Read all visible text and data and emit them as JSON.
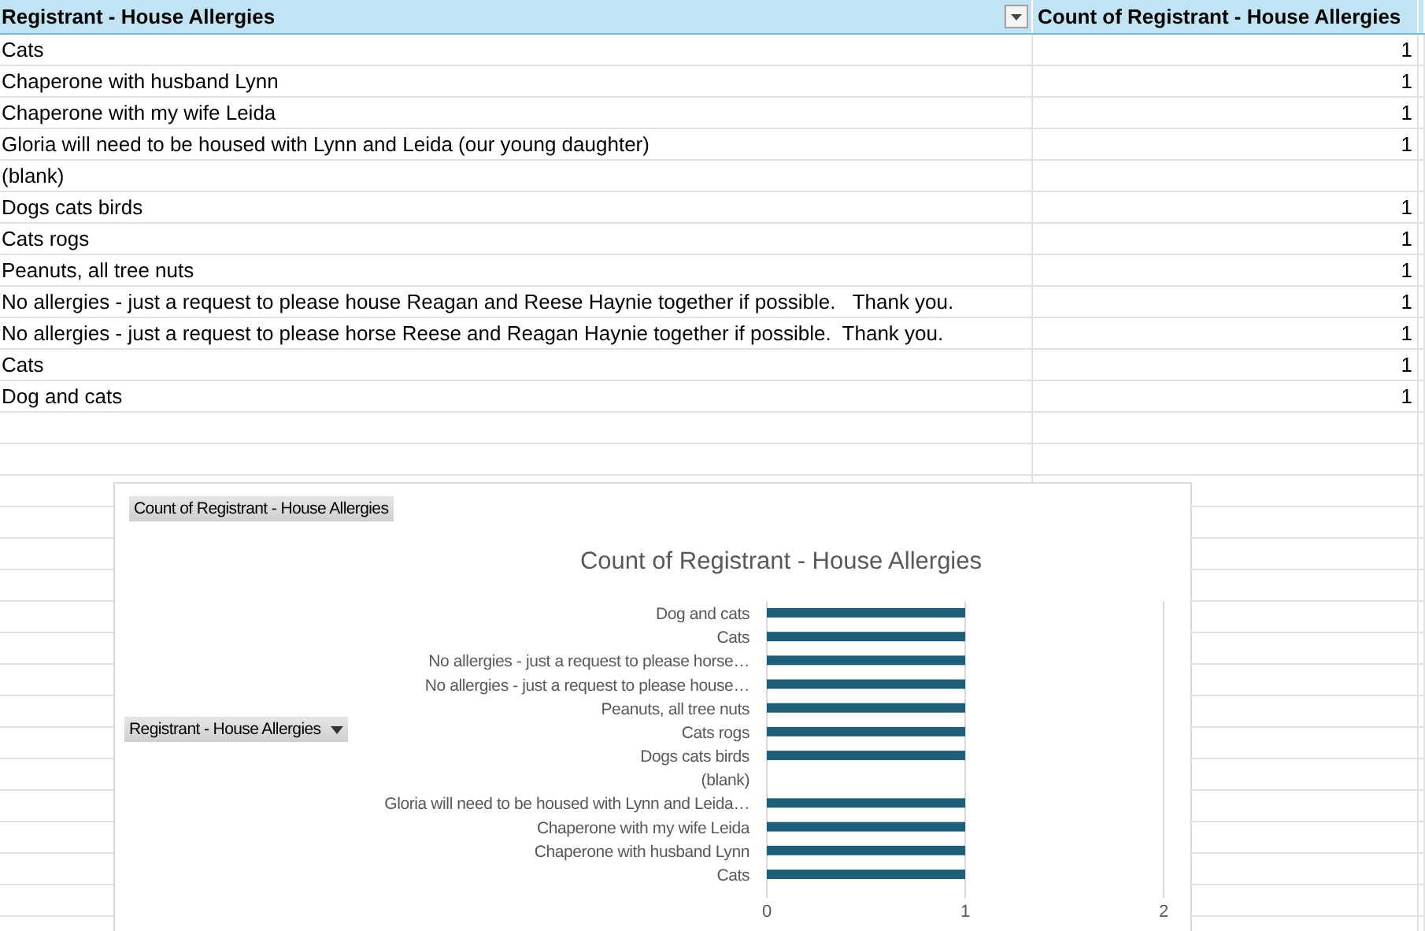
{
  "pivot_table": {
    "columns": [
      {
        "label": "Registrant - House Allergies",
        "filter_button": true
      },
      {
        "label": "Count of Registrant - House Allergies",
        "filter_button": false
      }
    ],
    "rows": [
      {
        "label": "Cats",
        "count": "1"
      },
      {
        "label": "Chaperone with husband Lynn",
        "count": "1"
      },
      {
        "label": "Chaperone with my wife Leida",
        "count": "1"
      },
      {
        "label": "Gloria will need to be housed with Lynn and Leida (our young daughter)",
        "count": "1"
      },
      {
        "label": "(blank)"
      },
      {
        "label": "Dogs cats birds",
        "count": "1"
      },
      {
        "label": "Cats rogs",
        "count": "1"
      },
      {
        "label": "Peanuts, all tree nuts",
        "count": "1"
      },
      {
        "label": "No allergies - just a request to please house Reagan and Reese Haynie together if possible.   Thank you.",
        "count": "1"
      },
      {
        "label": "No allergies - just a request to please horse Reese and Reagan Haynie together if possible.  Thank you.",
        "count": "1"
      },
      {
        "label": "Cats",
        "count": "1"
      },
      {
        "label": "Dog and cats",
        "count": "1"
      }
    ]
  },
  "chart": {
    "values_field_button": "Count of Registrant - House Allergies",
    "axis_field_button": "Registrant - House Allergies",
    "chart_data": {
      "type": "bar",
      "orientation": "horizontal",
      "title": "Count of Registrant - House Allergies",
      "categories": [
        "Dog and cats",
        "Cats",
        "No allergies - just a request to please horse…",
        "No allergies - just a request to please house…",
        "Peanuts, all tree nuts",
        "Cats rogs",
        "Dogs cats birds",
        "(blank)",
        "Gloria will need to be housed with Lynn and Leida…",
        "Chaperone with my wife Leida",
        "Chaperone with husband Lynn",
        "Cats"
      ],
      "series": [
        {
          "color": "#1f5f7a",
          "values": [
            1,
            1,
            1,
            1,
            1,
            1,
            1,
            null,
            1,
            1,
            1,
            1
          ]
        }
      ],
      "xlim": [
        0,
        2
      ],
      "xticks": [
        0,
        1,
        2
      ]
    }
  }
}
